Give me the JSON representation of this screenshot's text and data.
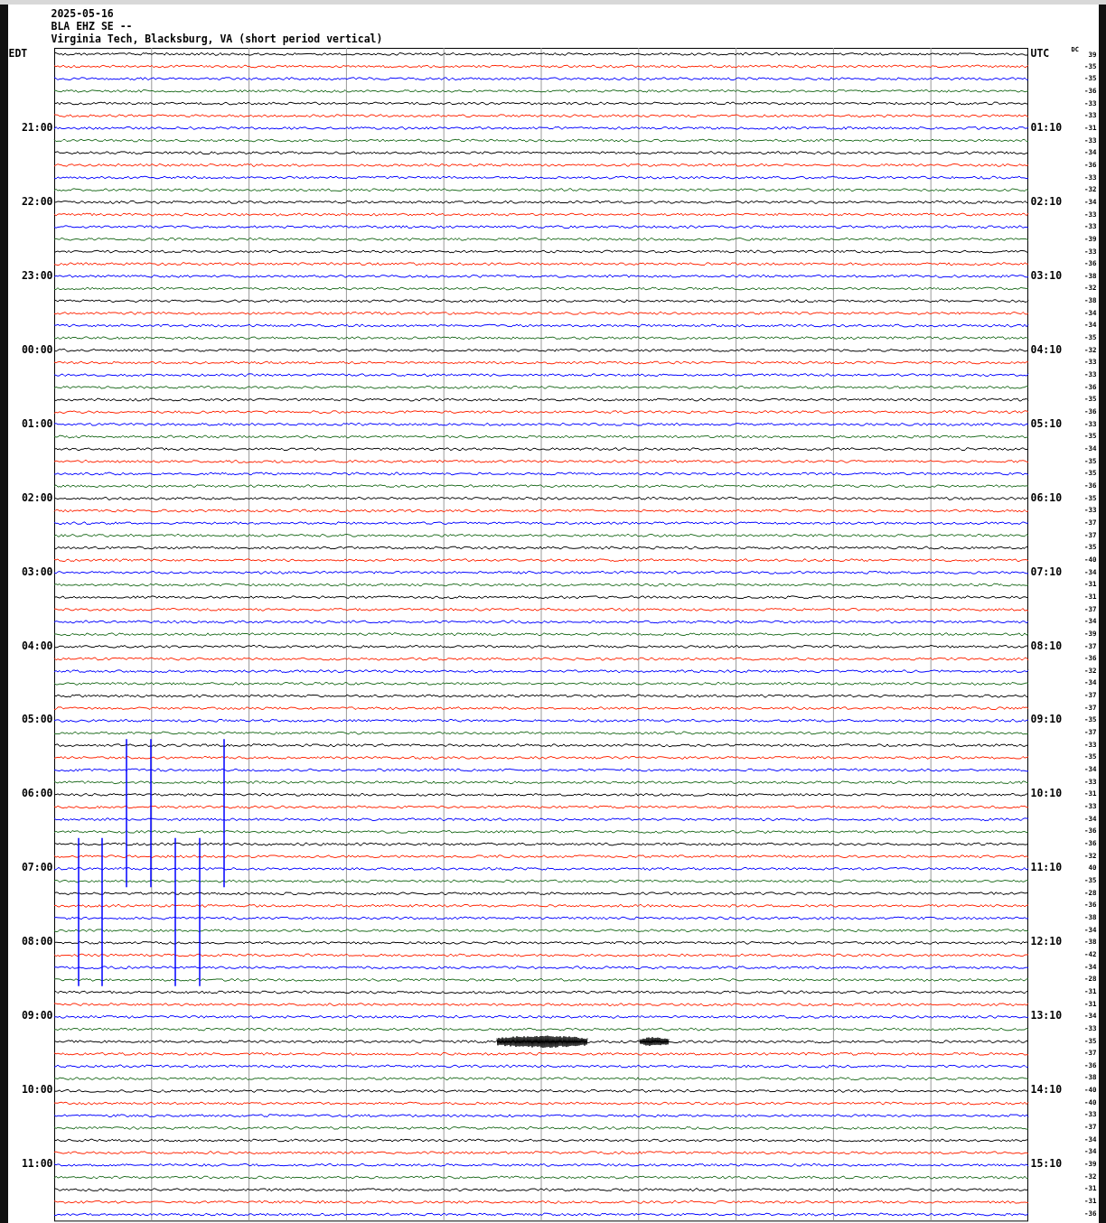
{
  "header": {
    "date": "2025-05-16",
    "station": "BLA EHZ SE --",
    "location": "Virginia Tech, Blacksburg, VA (short period vertical)"
  },
  "left_zone": "EDT",
  "right_zone": "UTC",
  "dc_label": "DC",
  "time_marks": [
    {
      "edt": "21:00",
      "utc": "01:10"
    },
    {
      "edt": "22:00",
      "utc": "02:10"
    },
    {
      "edt": "23:00",
      "utc": "03:10"
    },
    {
      "edt": "00:00",
      "utc": "04:10"
    },
    {
      "edt": "01:00",
      "utc": "05:10"
    },
    {
      "edt": "02:00",
      "utc": "06:10"
    },
    {
      "edt": "03:00",
      "utc": "07:10"
    },
    {
      "edt": "04:00",
      "utc": "08:10"
    },
    {
      "edt": "05:00",
      "utc": "09:10"
    },
    {
      "edt": "06:00",
      "utc": "10:10"
    },
    {
      "edt": "07:00",
      "utc": "11:10"
    },
    {
      "edt": "08:00",
      "utc": "12:10"
    },
    {
      "edt": "09:00",
      "utc": "13:10"
    },
    {
      "edt": "10:00",
      "utc": "14:10"
    },
    {
      "edt": "11:00",
      "utc": "15:10"
    }
  ],
  "traces": [
    {
      "dc": "39",
      "color": "#000000"
    },
    {
      "dc": "-35",
      "color": "#ff2200"
    },
    {
      "dc": "-35",
      "color": "#0000ff"
    },
    {
      "dc": "-36",
      "color": "#1e6b1e"
    },
    {
      "dc": "-33",
      "color": "#000000"
    },
    {
      "dc": "-33",
      "color": "#ff2200"
    },
    {
      "dc": "-31",
      "color": "#0000ff"
    },
    {
      "dc": "-33",
      "color": "#1e6b1e"
    },
    {
      "dc": "-34",
      "color": "#000000"
    },
    {
      "dc": "-36",
      "color": "#ff2200"
    },
    {
      "dc": "-33",
      "color": "#0000ff"
    },
    {
      "dc": "-32",
      "color": "#1e6b1e"
    },
    {
      "dc": "-34",
      "color": "#000000"
    },
    {
      "dc": "-33",
      "color": "#ff2200"
    },
    {
      "dc": "-33",
      "color": "#0000ff"
    },
    {
      "dc": "-39",
      "color": "#1e6b1e"
    },
    {
      "dc": "-33",
      "color": "#000000"
    },
    {
      "dc": "-36",
      "color": "#ff2200"
    },
    {
      "dc": "-38",
      "color": "#0000ff"
    },
    {
      "dc": "-32",
      "color": "#1e6b1e"
    },
    {
      "dc": "-38",
      "color": "#000000"
    },
    {
      "dc": "-34",
      "color": "#ff2200"
    },
    {
      "dc": "-34",
      "color": "#0000ff"
    },
    {
      "dc": "-35",
      "color": "#1e6b1e"
    },
    {
      "dc": "-32",
      "color": "#000000"
    },
    {
      "dc": "-33",
      "color": "#ff2200"
    },
    {
      "dc": "-33",
      "color": "#0000ff"
    },
    {
      "dc": "-36",
      "color": "#1e6b1e"
    },
    {
      "dc": "-35",
      "color": "#000000"
    },
    {
      "dc": "-36",
      "color": "#ff2200"
    },
    {
      "dc": "-33",
      "color": "#0000ff"
    },
    {
      "dc": "-35",
      "color": "#1e6b1e"
    },
    {
      "dc": "-34",
      "color": "#000000"
    },
    {
      "dc": "-35",
      "color": "#ff2200"
    },
    {
      "dc": "-35",
      "color": "#0000ff"
    },
    {
      "dc": "-36",
      "color": "#1e6b1e"
    },
    {
      "dc": "-35",
      "color": "#000000"
    },
    {
      "dc": "-33",
      "color": "#ff2200"
    },
    {
      "dc": "-37",
      "color": "#0000ff"
    },
    {
      "dc": "-37",
      "color": "#1e6b1e"
    },
    {
      "dc": "-35",
      "color": "#000000"
    },
    {
      "dc": "-40",
      "color": "#ff2200"
    },
    {
      "dc": "-34",
      "color": "#0000ff"
    },
    {
      "dc": "-31",
      "color": "#1e6b1e"
    },
    {
      "dc": "-31",
      "color": "#000000"
    },
    {
      "dc": "-37",
      "color": "#ff2200"
    },
    {
      "dc": "-34",
      "color": "#0000ff"
    },
    {
      "dc": "-39",
      "color": "#1e6b1e"
    },
    {
      "dc": "-37",
      "color": "#000000"
    },
    {
      "dc": "-36",
      "color": "#ff2200"
    },
    {
      "dc": "-32",
      "color": "#0000ff"
    },
    {
      "dc": "-34",
      "color": "#1e6b1e"
    },
    {
      "dc": "-37",
      "color": "#000000"
    },
    {
      "dc": "-37",
      "color": "#ff2200"
    },
    {
      "dc": "-35",
      "color": "#0000ff"
    },
    {
      "dc": "-37",
      "color": "#1e6b1e"
    },
    {
      "dc": "-33",
      "color": "#000000"
    },
    {
      "dc": "-35",
      "color": "#ff2200"
    },
    {
      "dc": "-34",
      "color": "#0000ff"
    },
    {
      "dc": "-33",
      "color": "#1e6b1e"
    },
    {
      "dc": "-31",
      "color": "#000000"
    },
    {
      "dc": "-33",
      "color": "#ff2200"
    },
    {
      "dc": "-34",
      "color": "#0000ff"
    },
    {
      "dc": "-36",
      "color": "#1e6b1e"
    },
    {
      "dc": "-36",
      "color": "#000000"
    },
    {
      "dc": "-32",
      "color": "#ff2200"
    },
    {
      "dc": "40",
      "color": "#0000ff"
    },
    {
      "dc": "-35",
      "color": "#1e6b1e"
    },
    {
      "dc": "-28",
      "color": "#000000"
    },
    {
      "dc": "-36",
      "color": "#ff2200"
    },
    {
      "dc": "-38",
      "color": "#0000ff"
    },
    {
      "dc": "-34",
      "color": "#1e6b1e"
    },
    {
      "dc": "-38",
      "color": "#000000"
    },
    {
      "dc": "-42",
      "color": "#ff2200"
    },
    {
      "dc": "-34",
      "color": "#0000ff"
    },
    {
      "dc": "-28",
      "color": "#1e6b1e"
    },
    {
      "dc": "-31",
      "color": "#000000"
    },
    {
      "dc": "-31",
      "color": "#ff2200"
    },
    {
      "dc": "-34",
      "color": "#0000ff"
    },
    {
      "dc": "-33",
      "color": "#1e6b1e"
    },
    {
      "dc": "-35",
      "color": "#000000"
    },
    {
      "dc": "-37",
      "color": "#ff2200"
    },
    {
      "dc": "-36",
      "color": "#0000ff"
    },
    {
      "dc": "-38",
      "color": "#1e6b1e"
    },
    {
      "dc": "-40",
      "color": "#000000"
    },
    {
      "dc": "-40",
      "color": "#ff2200"
    },
    {
      "dc": "-33",
      "color": "#0000ff"
    },
    {
      "dc": "-37",
      "color": "#1e6b1e"
    },
    {
      "dc": "-34",
      "color": "#000000"
    },
    {
      "dc": "-34",
      "color": "#ff2200"
    },
    {
      "dc": "-39",
      "color": "#0000ff"
    },
    {
      "dc": "-32",
      "color": "#1e6b1e"
    },
    {
      "dc": "-31",
      "color": "#000000"
    },
    {
      "dc": "-31",
      "color": "#ff2200"
    },
    {
      "dc": "-36",
      "color": "#0000ff"
    }
  ]
}
